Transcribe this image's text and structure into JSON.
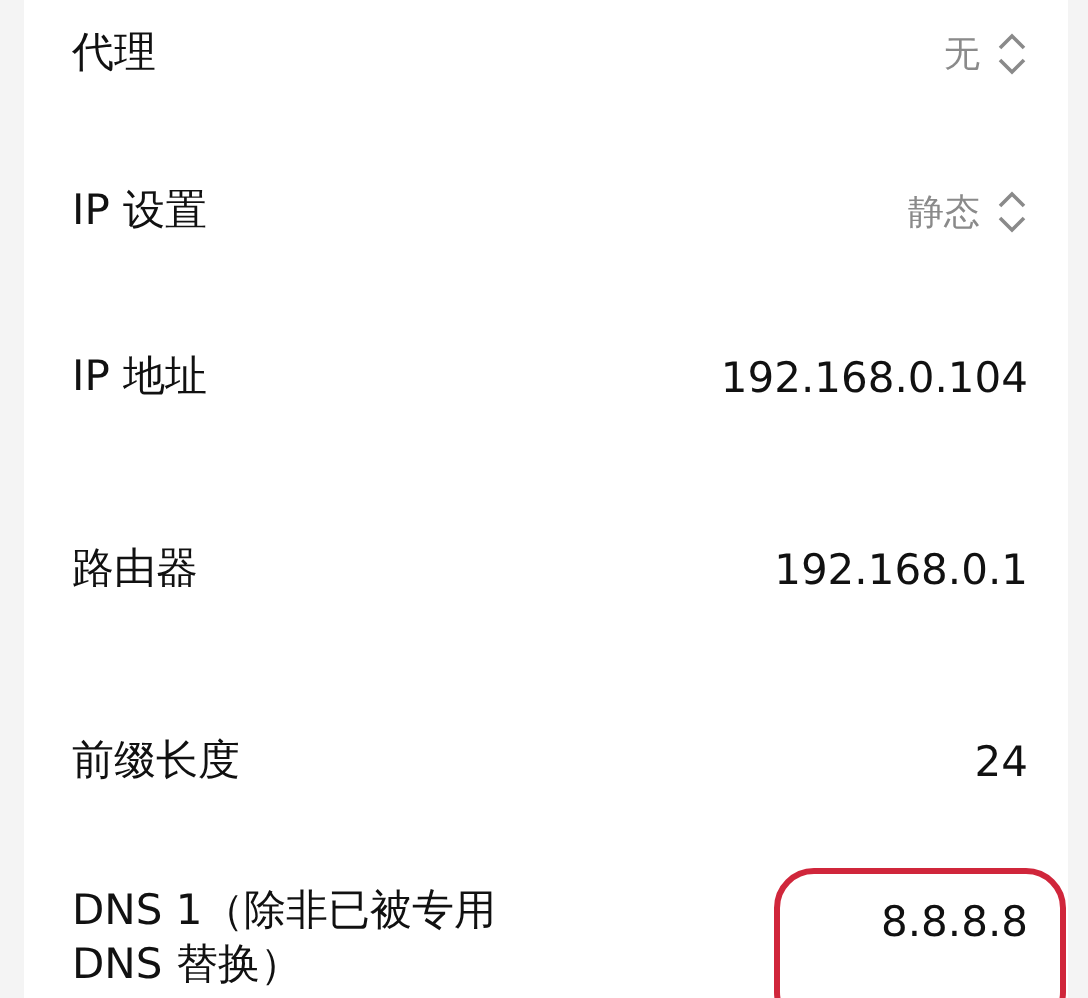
{
  "settings": [
    {
      "kind": "select",
      "label": "代理",
      "value": "无",
      "highlighted": false
    },
    {
      "kind": "select",
      "label": "IP 设置",
      "value": "静态",
      "highlighted": false
    },
    {
      "kind": "text",
      "label": "IP 地址",
      "value": "192.168.0.104",
      "highlighted": false
    },
    {
      "kind": "text",
      "label": "路由器",
      "value": "192.168.0.1",
      "highlighted": false
    },
    {
      "kind": "text",
      "label": "前缀长度",
      "value": "24",
      "highlighted": false
    },
    {
      "kind": "text",
      "label": "DNS 1（除非已被专用 DNS 替换）",
      "value": "8.8.8.8",
      "highlighted": true
    }
  ]
}
